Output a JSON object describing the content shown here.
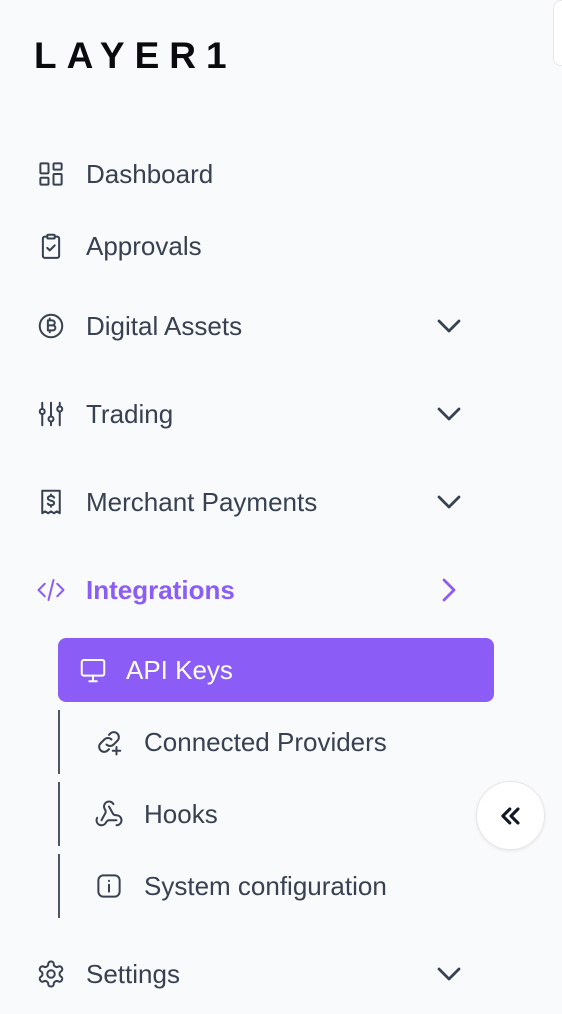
{
  "brand": {
    "logo_text": "LAYER1"
  },
  "colors": {
    "accent": "#8b5cf6",
    "text": "#374151",
    "background": "#f9fafb"
  },
  "nav": {
    "dashboard": {
      "label": "Dashboard",
      "icon": "dashboard-grid-icon"
    },
    "approvals": {
      "label": "Approvals",
      "icon": "clipboard-check-icon"
    },
    "digital_assets": {
      "label": "Digital Assets",
      "icon": "bitcoin-icon",
      "expanded": false
    },
    "trading": {
      "label": "Trading",
      "icon": "sliders-icon",
      "expanded": false
    },
    "merchant_payments": {
      "label": "Merchant Payments",
      "icon": "receipt-dollar-icon",
      "expanded": false
    },
    "integrations": {
      "label": "Integrations",
      "icon": "code-icon",
      "active": true,
      "children": [
        {
          "label": "API Keys",
          "icon": "monitor-icon",
          "active": true
        },
        {
          "label": "Connected Providers",
          "icon": "link-plus-icon"
        },
        {
          "label": "Hooks",
          "icon": "webhook-icon"
        },
        {
          "label": "System configuration",
          "icon": "info-icon"
        }
      ]
    },
    "settings": {
      "label": "Settings",
      "icon": "gear-icon",
      "expanded": false
    }
  },
  "collapse_button": {
    "icon": "double-chevron-left-icon"
  }
}
